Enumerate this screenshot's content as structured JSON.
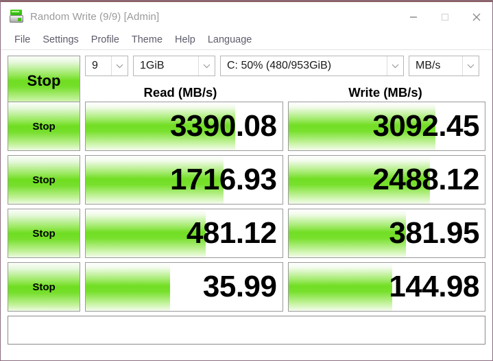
{
  "window": {
    "title": "Random Write (9/9) [Admin]",
    "icon": "disk-drive-icon",
    "border_color": "#8b6b80",
    "controls": {
      "minimize": "minimize-icon",
      "maximize": "maximize-icon",
      "close": "close-icon"
    }
  },
  "menubar": {
    "items": [
      {
        "label": "File"
      },
      {
        "label": "Settings"
      },
      {
        "label": "Profile"
      },
      {
        "label": "Theme"
      },
      {
        "label": "Help"
      },
      {
        "label": "Language"
      }
    ]
  },
  "toolbar": {
    "all_button_label": "Stop",
    "combos": [
      {
        "name": "test-count",
        "value": "9"
      },
      {
        "name": "test-size",
        "value": "1GiB"
      },
      {
        "name": "target-drive",
        "value": "C: 50% (480/953GiB)"
      },
      {
        "name": "unit",
        "value": "MB/s"
      }
    ]
  },
  "table": {
    "headers": {
      "read": "Read (MB/s)",
      "write": "Write (MB/s)"
    },
    "row_button_label": "Stop",
    "rows": [
      {
        "read_value": "3390.08",
        "read_fill": 76,
        "write_value": "3092.45",
        "write_fill": 75
      },
      {
        "read_value": "1716.93",
        "read_fill": 70,
        "write_value": "2488.12",
        "write_fill": 72
      },
      {
        "read_value": "481.12",
        "read_fill": 61,
        "write_value": "381.95",
        "write_fill": 60
      },
      {
        "read_value": "35.99",
        "read_fill": 43,
        "write_value": "144.98",
        "write_fill": 53
      }
    ]
  },
  "status": {
    "text": ""
  },
  "colors": {
    "accent_green": "#6fdd20",
    "title_text": "#9a9a9a",
    "menu_text": "#5c5c6b",
    "window_border": "#8b6b80"
  }
}
